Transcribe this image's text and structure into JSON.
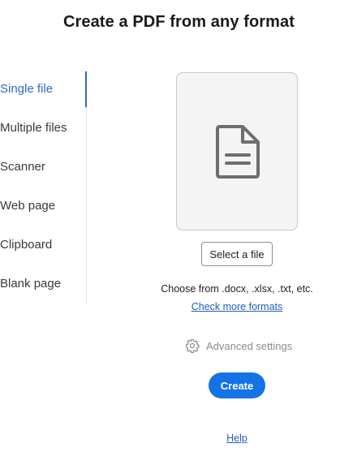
{
  "header": {
    "title": "Create a PDF from any format"
  },
  "nav": {
    "active_index": 0,
    "accent_color": "#2c6bbf",
    "items": [
      {
        "label": "Single file"
      },
      {
        "label": "Multiple files"
      },
      {
        "label": "Scanner"
      },
      {
        "label": "Web page"
      },
      {
        "label": "Clipboard"
      },
      {
        "label": "Blank page"
      }
    ]
  },
  "main": {
    "drop_zone_icon": "document-icon",
    "select_button_label": "Select a file",
    "formats_text": "Choose from .docx, .xlsx, .txt, etc.",
    "check_formats_link": "Check more formats",
    "advanced_icon": "gear-icon",
    "advanced_label": "Advanced settings",
    "create_button_label": "Create",
    "create_button_color": "#1473e6",
    "help_link": "Help"
  }
}
